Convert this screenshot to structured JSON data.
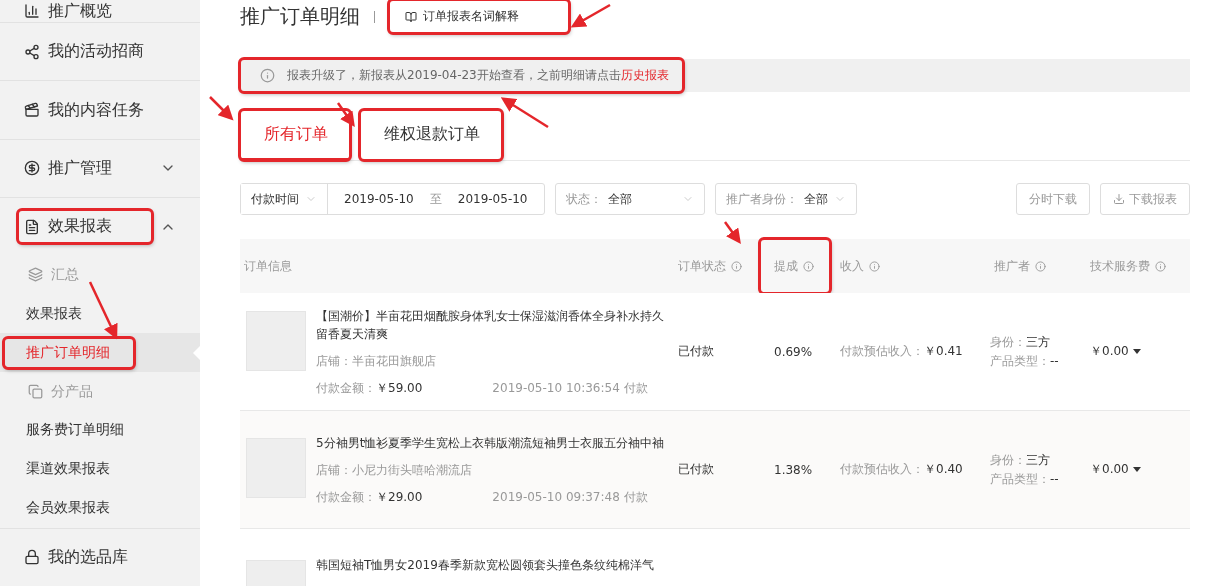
{
  "sidebar": {
    "items": [
      {
        "kind": "item",
        "label": "推广概览",
        "annotated": false
      },
      {
        "kind": "item",
        "label": "我的活动招商",
        "annotated": false
      },
      {
        "kind": "item",
        "label": "我的内容任务",
        "annotated": false
      },
      {
        "kind": "item",
        "label": "推广管理",
        "expanded": false,
        "annotated": false
      },
      {
        "kind": "item",
        "label": "效果报表",
        "expanded": true,
        "annotated": true,
        "children": [
          {
            "kind": "group",
            "label": "汇总"
          },
          {
            "kind": "link",
            "label": "效果报表",
            "selected": false,
            "annotated": false
          },
          {
            "kind": "link",
            "label": "推广订单明细",
            "selected": true,
            "annotated": true
          },
          {
            "kind": "group",
            "label": "分产品"
          },
          {
            "kind": "link",
            "label": "服务费订单明细",
            "selected": false,
            "annotated": false
          },
          {
            "kind": "link",
            "label": "渠道效果报表",
            "selected": false,
            "annotated": false
          },
          {
            "kind": "link",
            "label": "会员效果报表",
            "selected": false,
            "annotated": false
          }
        ]
      },
      {
        "kind": "item",
        "label": "我的选品库",
        "annotated": false
      }
    ]
  },
  "page": {
    "title": "推广订单明细",
    "help_link": {
      "label": "订单报表名词解释",
      "annotated": true
    }
  },
  "notice": {
    "text": "报表升级了，新报表从2019-04-23开始查看，之前明细请点击",
    "link": "历史报表",
    "annotated": true
  },
  "tabs": [
    {
      "label": "所有订单",
      "selected": true,
      "annotated": true
    },
    {
      "label": "维权退款订单",
      "selected": false,
      "annotated": true
    }
  ],
  "filters": {
    "time_type": "付款时间",
    "date_from": "2019-05-10",
    "date_sep": "至",
    "date_to": "2019-05-10",
    "status": {
      "label": "状态：",
      "value": "全部"
    },
    "role": {
      "label": "推广者身份：",
      "value": "全部"
    },
    "buttons": [
      {
        "label": "分时下载"
      },
      {
        "label": "下载报表"
      }
    ]
  },
  "table": {
    "columns": [
      {
        "label": "订单信息",
        "annotated": false
      },
      {
        "label": "订单状态",
        "annotated": false
      },
      {
        "label": "提成",
        "annotated": true
      },
      {
        "label": "收入",
        "annotated": false
      },
      {
        "label": "推广者",
        "annotated": false
      },
      {
        "label": "技术服务费",
        "annotated": false
      }
    ],
    "rows": [
      {
        "title": "【国潮价】半亩花田烟酰胺身体乳女士保湿滋润香体全身补水持久留香夏天清爽",
        "shop": "店铺：半亩花田旗舰店",
        "amount_label": "付款金额：",
        "amount": "￥59.00",
        "time": "2019-05-10 10:36:54 付款",
        "status": "已付款",
        "rate": "0.69%",
        "income_label": "付款预估收入：",
        "income": "￥0.41",
        "role_label": "身份：",
        "role": "三方",
        "type_label": "产品类型：",
        "type": "--",
        "fee": "￥0.00"
      },
      {
        "title": "5分袖男t恤衫夏季学生宽松上衣韩版潮流短袖男士衣服五分袖中袖",
        "shop": "店铺：小尼力街头嘻哈潮流店",
        "amount_label": "付款金额：",
        "amount": "￥29.00",
        "time": "2019-05-10 09:37:48 付款",
        "status": "已付款",
        "rate": "1.38%",
        "income_label": "付款预估收入：",
        "income": "￥0.40",
        "role_label": "身份：",
        "role": "三方",
        "type_label": "产品类型：",
        "type": "--",
        "fee": "￥0.00"
      },
      {
        "title": "韩国短袖T恤男女2019春季新款宽松圆领套头撞色条纹纯棉洋气"
      }
    ]
  }
}
